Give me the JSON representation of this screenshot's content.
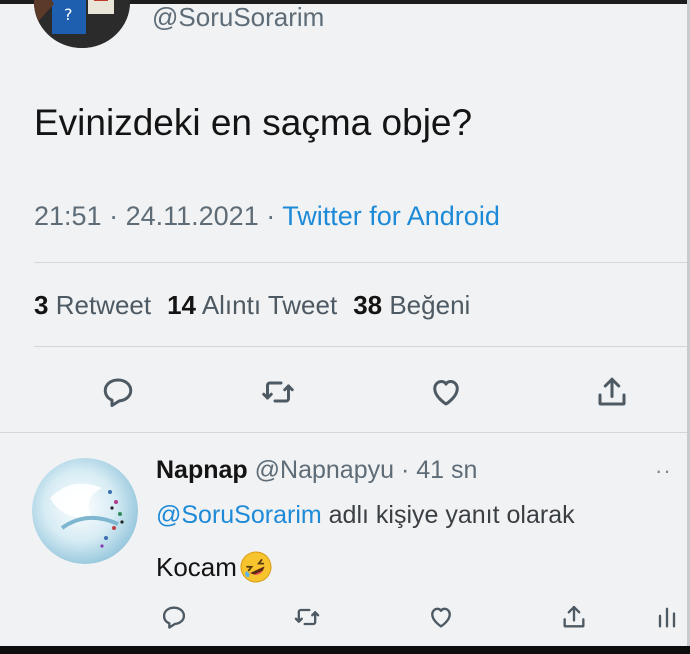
{
  "tweet": {
    "handle": "@SoruSorarim",
    "text": "Evinizdeki en saçma obje?",
    "time": "21:51",
    "separator": " · ",
    "date": "24.11.2021",
    "source": "Twitter for Android",
    "stats": {
      "retweets_count": "3",
      "retweets_label": "Retweet",
      "quotes_count": "14",
      "quotes_label": "Alıntı Tweet",
      "likes_count": "38",
      "likes_label": "Beğeni"
    },
    "actions": [
      "reply-icon",
      "retweet-icon",
      "like-icon",
      "share-icon"
    ]
  },
  "reply": {
    "name": "Napnap",
    "handle": "@Napnapyu",
    "separator": " · ",
    "age": "41 sn",
    "more": "··",
    "replying_mention": "@SoruSorarim",
    "replying_rest": " adlı kişiye yanıt olarak",
    "text": "Kocam",
    "actions": [
      "reply-icon",
      "retweet-icon",
      "like-icon",
      "share-icon",
      "analytics-icon"
    ]
  },
  "colors": {
    "background": "#f1f2f3",
    "link": "#1d8ad8",
    "muted": "#5e6c77",
    "text": "#141414"
  }
}
